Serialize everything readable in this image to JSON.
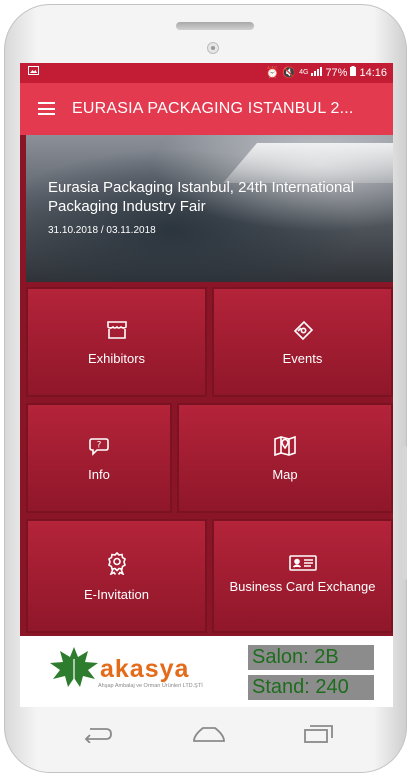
{
  "status_bar": {
    "network": "4G",
    "battery": "77%",
    "time": "14:16"
  },
  "app_bar": {
    "title": "EURASIA PACKAGING ISTANBUL 2..."
  },
  "hero": {
    "title": "Eurasia Packaging Istanbul, 24th International Packaging Industry Fair",
    "dates": "31.10.2018 / 03.11.2018"
  },
  "menu": {
    "exhibitors": {
      "label": "Exhibitors",
      "icon": "store-icon"
    },
    "events": {
      "label": "Events",
      "icon": "ticket-icon"
    },
    "info": {
      "label": "Info",
      "icon": "chat-question-icon"
    },
    "map": {
      "label": "Map",
      "icon": "map-pin-icon"
    },
    "invitation": {
      "label": "E-Invitation",
      "icon": "award-ribbon-icon"
    },
    "business_card": {
      "label": "Business Card Exchange",
      "icon": "id-card-icon"
    }
  },
  "banner": {
    "brand": "akasya",
    "tagline": "Ahşap Ambalaj ve Orman Ürünleri LTD.ŞTİ",
    "salon": "Salon: 2B",
    "stand": "Stand: 240"
  },
  "colors": {
    "app_bar": "#e43a4f",
    "status_bar": "#c21d34",
    "tile": "#a11d33",
    "logo_orange": "#e36b1a",
    "logo_green": "#2e7d2e"
  }
}
